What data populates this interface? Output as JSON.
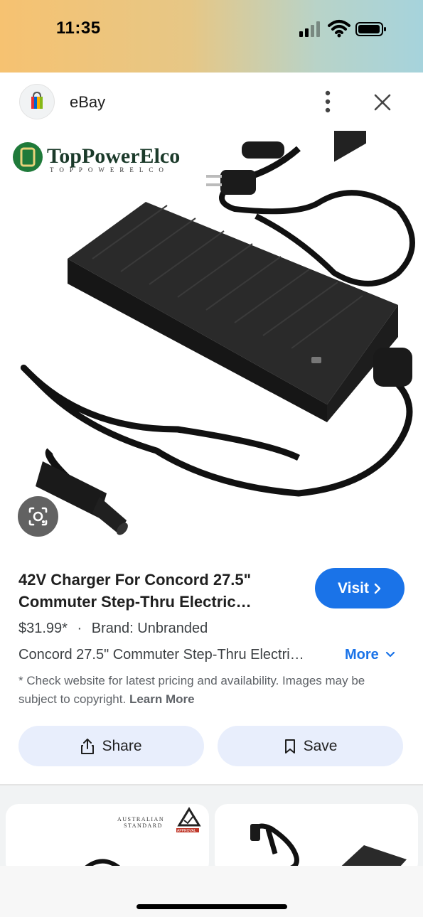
{
  "status_bar": {
    "time": "11:35"
  },
  "header": {
    "site_name": "eBay",
    "logo_icon": "ebay-shopping-bag-icon"
  },
  "product": {
    "image_brand_text": "TopPowerElco",
    "image_brand_subtext": "TOPPOWERELCO",
    "title_line1": "42V Charger For Concord 27.5\"",
    "title_line2": "Commuter Step-Thru Electric…",
    "visit_label": "Visit",
    "price": "$31.99*",
    "separator": "·",
    "brand": "Brand: Unbranded",
    "description": "Concord 27.5\" Commuter Step-Thru Electri…",
    "more_label": "More",
    "disclaimer": "* Check website for latest pricing and availability. Images may be subject to copyright.",
    "learn_more": "Learn More"
  },
  "actions": {
    "share_label": "Share",
    "save_label": "Save"
  },
  "related": {
    "card1_badge_line1": "AUSTRALIAN",
    "card1_badge_line2": "STANDARD",
    "card1_badge_line3": "APPROVAL"
  },
  "colors": {
    "accent": "#1a73e8",
    "pill_bg": "#e8eefc",
    "brand_green": "#1f7a3a"
  }
}
